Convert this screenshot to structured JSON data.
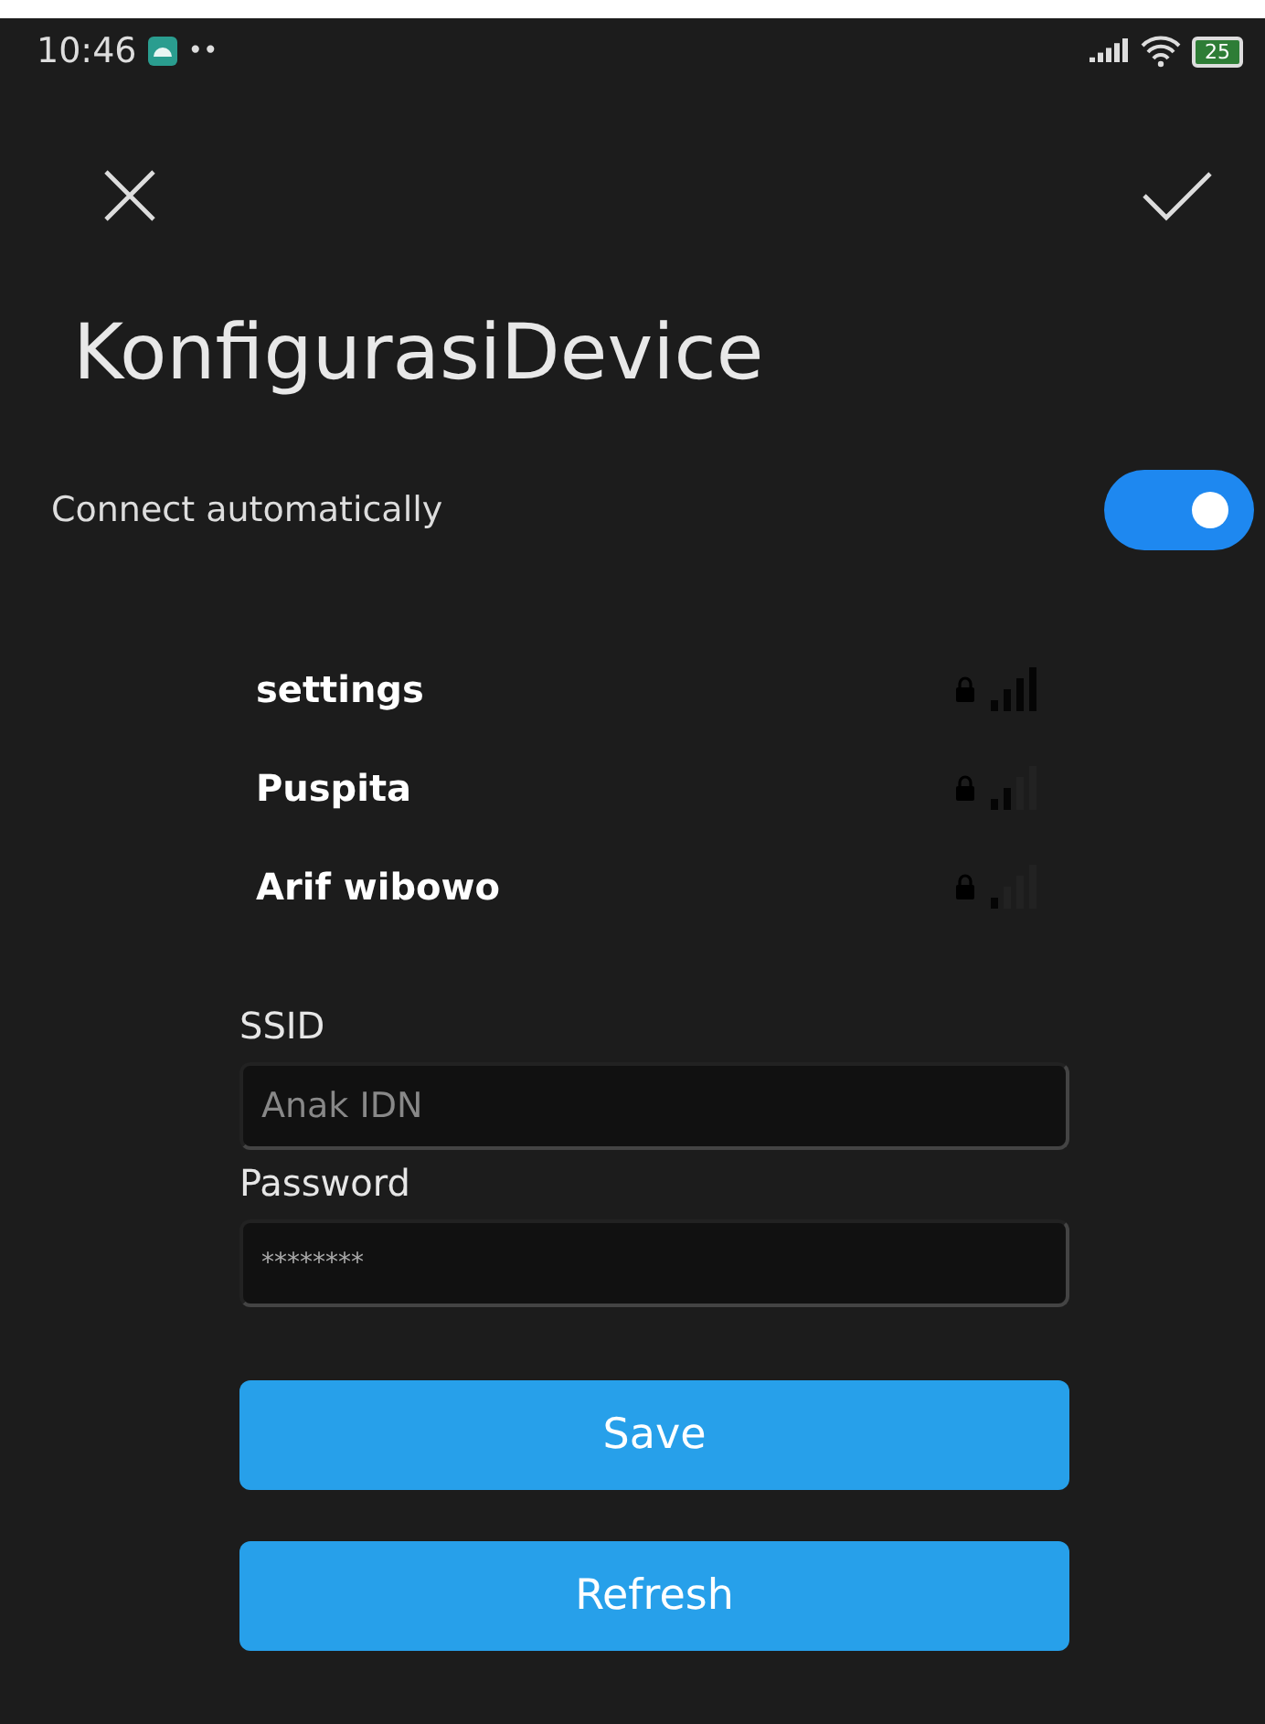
{
  "status_bar": {
    "time": "10:46",
    "dots": "••",
    "battery": "25"
  },
  "title": "KonfigurasiDevice",
  "connect_automatically": {
    "label": "Connect automatically",
    "on": true
  },
  "networks": [
    {
      "name": "settings",
      "kind": "strong"
    },
    {
      "name": "Puspita",
      "kind": "medium"
    },
    {
      "name": "Arif wibowo",
      "kind": "weak"
    }
  ],
  "ssid": {
    "label": "SSID",
    "placeholder": "Anak IDN"
  },
  "password": {
    "label": "Password",
    "value": "********"
  },
  "buttons": [
    "Save",
    "Refresh"
  ]
}
